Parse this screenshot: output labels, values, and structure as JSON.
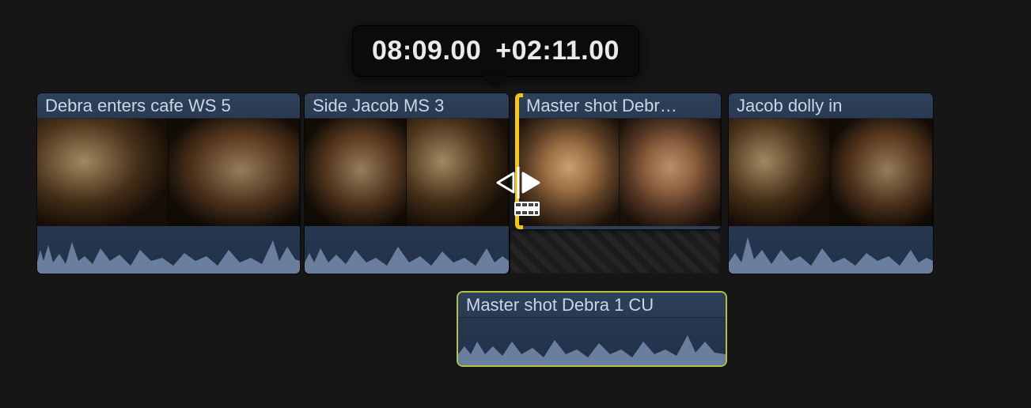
{
  "timecode": {
    "current": "08:09.00",
    "delta": "+02:11.00"
  },
  "clips": {
    "c1": {
      "label": "Debra enters cafe WS 5"
    },
    "c2": {
      "label": "Side Jacob MS 3"
    },
    "c3": {
      "label": "Master shot Debr…"
    },
    "c4": {
      "label": "Jacob dolly in"
    }
  },
  "connected_audio": {
    "label": "Master shot Debra 1 CU"
  }
}
